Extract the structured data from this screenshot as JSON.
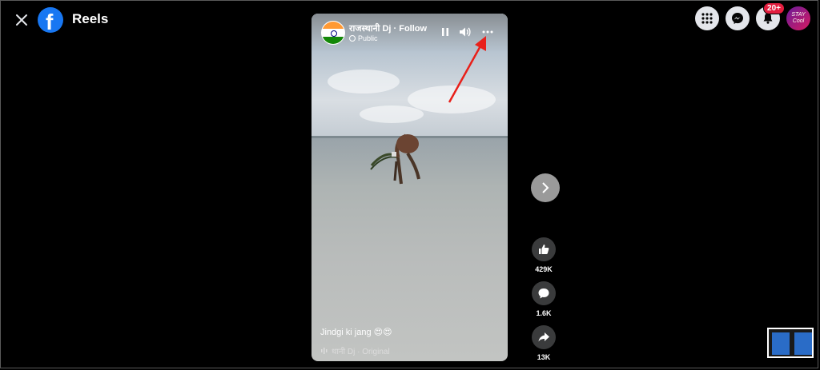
{
  "header": {
    "title": "Reels",
    "close_icon": "close-icon",
    "logo_icon": "facebook-logo-icon"
  },
  "top_right": {
    "menu_icon": "grid-menu-icon",
    "messenger_icon": "messenger-icon",
    "notifications_icon": "bell-icon",
    "notifications_badge": "20+",
    "profile_avatar_text": "STAY Cool"
  },
  "reel": {
    "page_name": "राजस्थानी Dj · Follow",
    "privacy": "Public",
    "caption": "Jindgi ki jang 😍😍",
    "audio": "थानी Dj · Original",
    "controls": {
      "pause_icon": "pause-icon",
      "volume_icon": "volume-icon",
      "more_icon": "more-options-icon"
    }
  },
  "actions": {
    "likes": "429K",
    "comments": "1.6K",
    "shares": "13K"
  },
  "colors": {
    "facebook_blue": "#1877f2",
    "badge_red": "#e41e3f",
    "annotation_arrow": "#e8201a"
  }
}
